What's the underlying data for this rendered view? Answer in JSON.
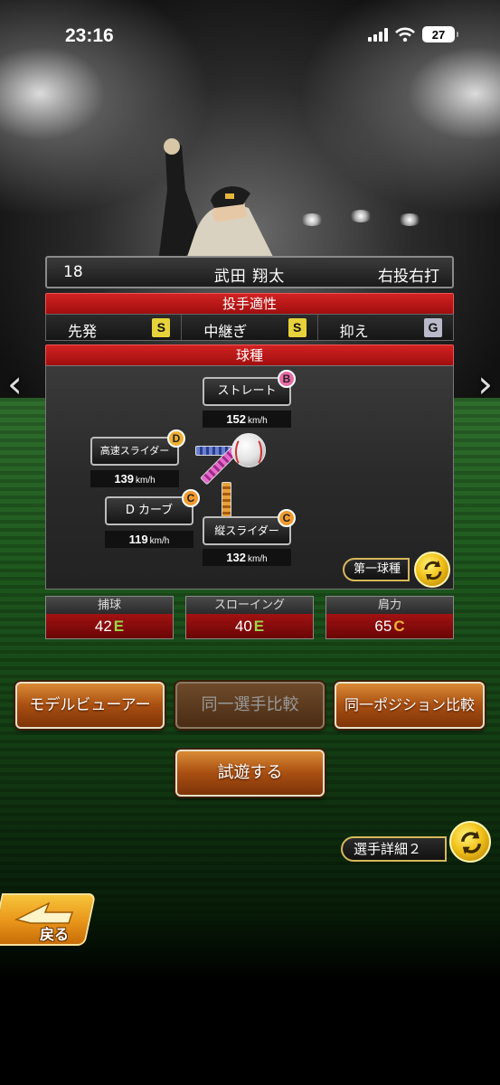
{
  "status_bar": {
    "time": "23:16",
    "battery": "27"
  },
  "player": {
    "number": "18",
    "name": "武田 翔太",
    "handedness": "右投右打"
  },
  "aptitude": {
    "header": "投手適性",
    "roles": [
      {
        "label": "先発",
        "grade": "S",
        "color": "#e6d23a"
      },
      {
        "label": "中継ぎ",
        "grade": "S",
        "color": "#e6d23a"
      },
      {
        "label": "抑え",
        "grade": "G",
        "color": "#b9b9c9"
      }
    ]
  },
  "pitches": {
    "header": "球種",
    "items": [
      {
        "name": "ストレート",
        "grade": "B",
        "grade_color": "#e86aa6",
        "speed": "152",
        "unit": "km/h"
      },
      {
        "name": "高速スライダー",
        "grade": "D",
        "grade_color": "#f0b030",
        "speed": "139",
        "unit": "km/h"
      },
      {
        "name": "D カーブ",
        "grade": "C",
        "grade_color": "#f09a30",
        "speed": "119",
        "unit": "km/h"
      },
      {
        "name": "縦スライダー",
        "grade": "C",
        "grade_color": "#f09a30",
        "speed": "132",
        "unit": "km/h"
      }
    ],
    "toggle_label": "第一球種"
  },
  "stats": [
    {
      "label": "捕球",
      "value": "42",
      "grade": "E",
      "grade_color": "#9ad94a"
    },
    {
      "label": "スローイング",
      "value": "40",
      "grade": "E",
      "grade_color": "#9ad94a"
    },
    {
      "label": "肩力",
      "value": "65",
      "grade": "C",
      "grade_color": "#f2b233"
    }
  ],
  "buttons": {
    "model_viewer": "モデルビューアー",
    "same_player_compare": "同一選手比較",
    "same_position_compare": "同一ポジション比較",
    "try_out": "試遊する",
    "player_detail_2": "選手詳細２",
    "back": "戻る"
  }
}
